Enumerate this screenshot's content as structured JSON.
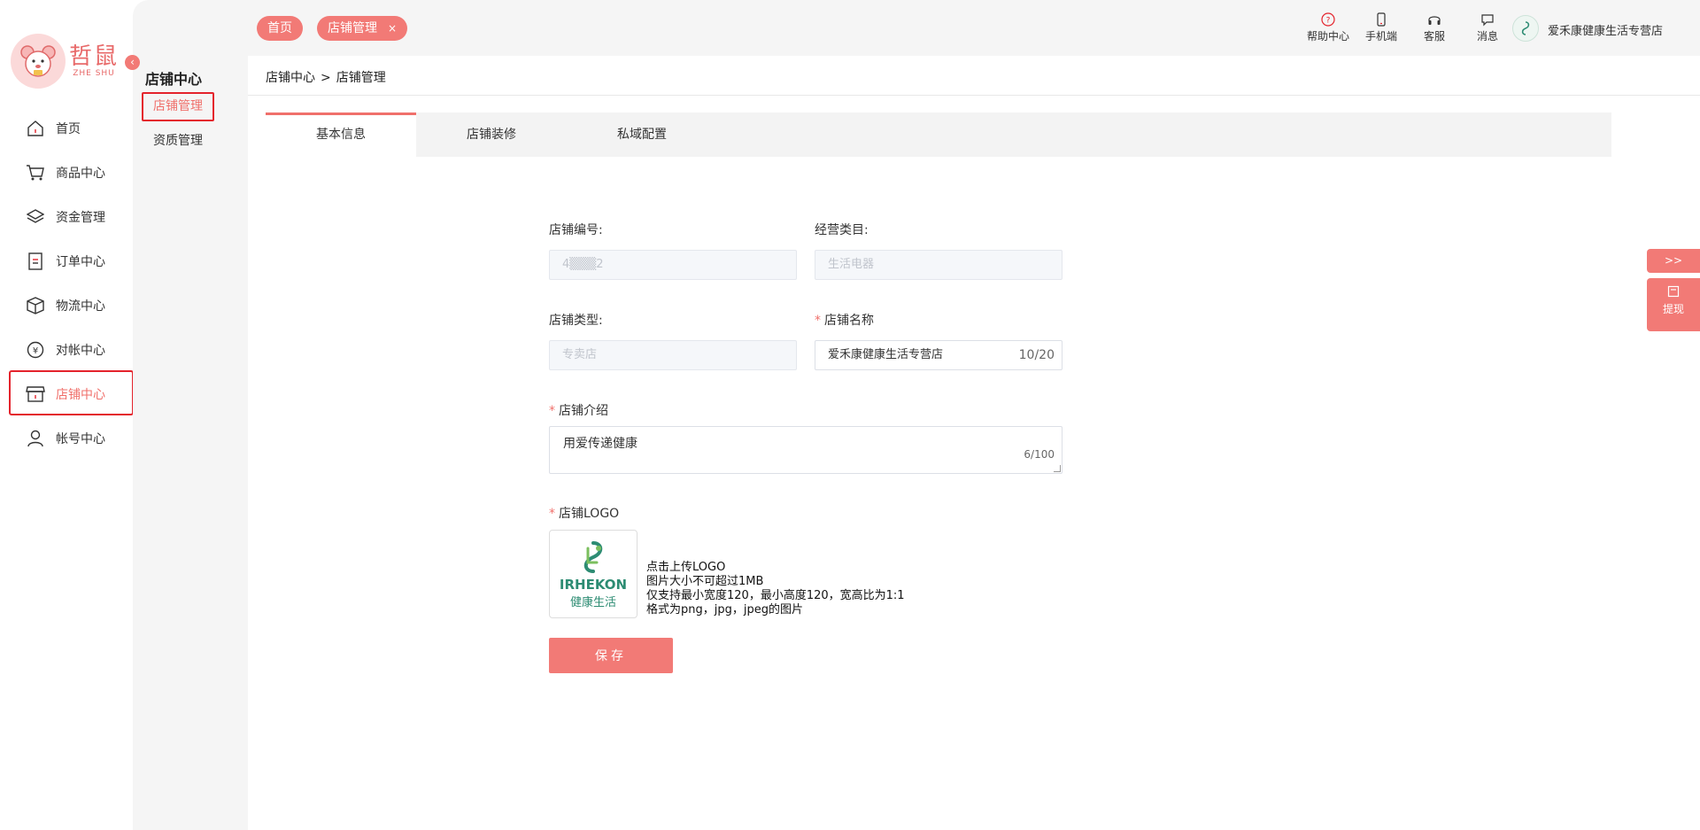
{
  "sidebar": {
    "logo_cn": "哲鼠",
    "logo_en": "ZHE SHU",
    "items": [
      {
        "label": "首页",
        "icon": "home-icon"
      },
      {
        "label": "商品中心",
        "icon": "cart-icon"
      },
      {
        "label": "资金管理",
        "icon": "layers-icon"
      },
      {
        "label": "订单中心",
        "icon": "order-icon"
      },
      {
        "label": "物流中心",
        "icon": "box-icon"
      },
      {
        "label": "对帐中心",
        "icon": "yuan-icon"
      },
      {
        "label": "店铺中心",
        "icon": "store-icon"
      },
      {
        "label": "帐号中心",
        "icon": "user-icon"
      }
    ],
    "active_index": 6
  },
  "subnav": {
    "title": "店铺中心",
    "items": [
      {
        "label": "店铺管理"
      },
      {
        "label": "资质管理"
      }
    ]
  },
  "topbar": {
    "tabs": [
      {
        "label": "首页"
      },
      {
        "label": "店铺管理",
        "close": "×"
      }
    ],
    "actions": [
      {
        "label": "帮助中心",
        "icon": "help-icon"
      },
      {
        "label": "手机端",
        "icon": "phone-icon"
      },
      {
        "label": "客服",
        "icon": "headset-icon"
      },
      {
        "label": "消息",
        "icon": "message-icon"
      }
    ],
    "store_name": "爱禾康健康生活专营店"
  },
  "breadcrumb": {
    "root": "店铺中心",
    "sep": ">",
    "current": "店铺管理"
  },
  "tabs": [
    {
      "label": "基本信息"
    },
    {
      "label": "店铺装修"
    },
    {
      "label": "私域配置"
    }
  ],
  "form": {
    "store_no_label": "店铺编号:",
    "store_no_value": "4▒▒▒2",
    "category_label": "经营类目:",
    "category_value": "生活电器",
    "type_label": "店铺类型:",
    "type_value": "专卖店",
    "name_label": "店铺名称",
    "name_value": "爱禾康健康生活专营店",
    "name_count": "10/20",
    "intro_label": "店铺介绍",
    "intro_value": "用爱传递健康",
    "intro_count": "6/100",
    "logo_label": "店铺LOGO",
    "logo_brand_en": "IRHEKON",
    "logo_brand_cn": "健康生活",
    "upload_hints": [
      "点击上传LOGO",
      "图片大小不可超过1MB",
      "仅支持最小宽度120，最小高度120，宽高比为1:1",
      "格式为png，jpg，jpeg的图片"
    ],
    "required_mark": "*",
    "save_label": "保存"
  },
  "floating": {
    "expand_label": ">>",
    "withdraw_label": "提现"
  },
  "colors": {
    "accent": "#f27a76",
    "highlight": "#e4232c",
    "brand_green": "#2d8c73"
  }
}
